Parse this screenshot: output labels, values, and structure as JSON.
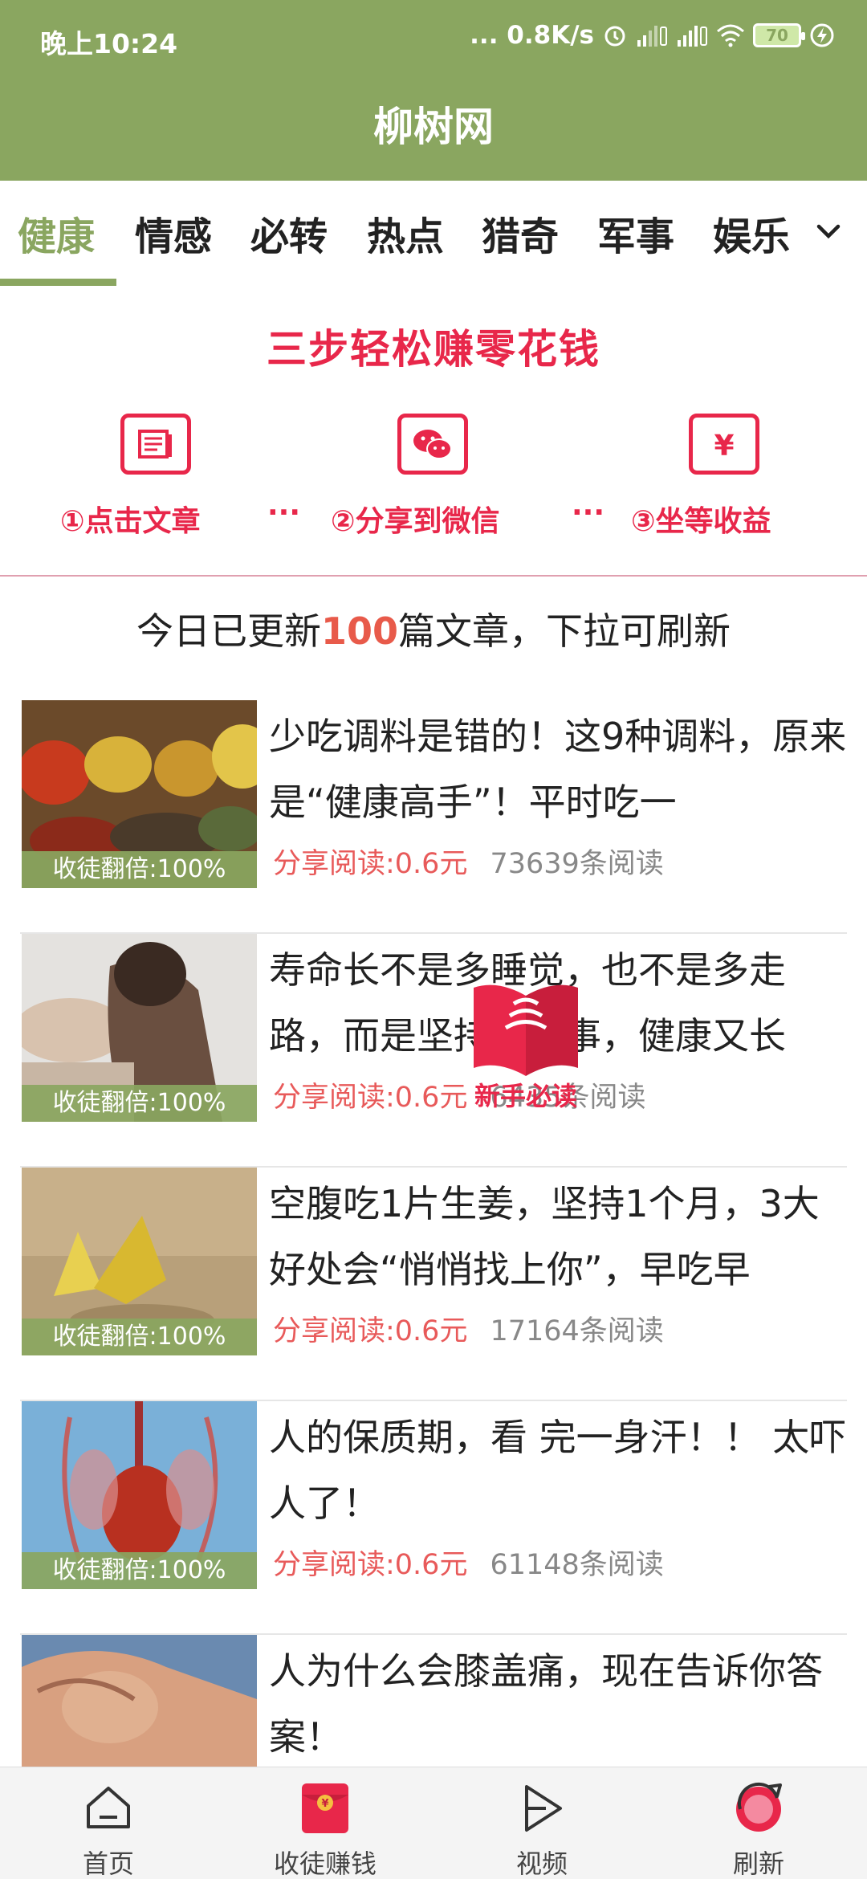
{
  "status_bar": {
    "time": "晚上10:24",
    "net_speed": "... 0.8K/s",
    "battery": "70"
  },
  "app": {
    "title": "柳树网"
  },
  "tabs": [
    {
      "label": "健康",
      "active": true
    },
    {
      "label": "情感"
    },
    {
      "label": "必转"
    },
    {
      "label": "热点"
    },
    {
      "label": "猎奇"
    },
    {
      "label": "军事"
    },
    {
      "label": "娱乐"
    }
  ],
  "promo": {
    "title": "三步轻松赚零花钱",
    "steps": [
      {
        "label": "①点击文章",
        "icon": "article-icon"
      },
      {
        "label": "②分享到微信",
        "icon": "wechat-icon"
      },
      {
        "label": "③坐等收益",
        "icon": "yuan-icon"
      }
    ],
    "dots": "···"
  },
  "notice": {
    "prefix": "今日已更新",
    "count": "100",
    "suffix": "篇文章，下拉可刷新"
  },
  "articles": [
    {
      "title": "少吃调料是错的！这9种调料，原来是“健康高手”！平时吃一",
      "badge": "收徒翻倍:100%",
      "share": "分享阅读:0.6元",
      "reads": "73639条阅读"
    },
    {
      "title": " 寿命长不是多睡觉，也不是多走路，而是坚持一件事，健康又长",
      "badge": "收徒翻倍:100%",
      "share": "分享阅读:0.6元",
      "reads": "6435条阅读"
    },
    {
      "title": "空腹吃1片生姜，坚持1个月，3大好处会“悄悄找上你”，早吃早",
      "badge": "收徒翻倍:100%",
      "share": "分享阅读:0.6元",
      "reads": "17164条阅读"
    },
    {
      "title": "人的保质期，看 完一身汗！！ 太吓人了！",
      "badge": "收徒翻倍:100%",
      "share": "分享阅读:0.6元",
      "reads": "61148条阅读"
    },
    {
      "title": " 人为什么会膝盖痛，现在告诉你答案！",
      "badge": "",
      "share": "",
      "reads": ""
    }
  ],
  "float_badge": {
    "label": "新手必读",
    "icon": "book-icon"
  },
  "bottom_nav": [
    {
      "label": "首页",
      "icon": "home-icon"
    },
    {
      "label": "收徒赚钱",
      "icon": "red-envelope-icon"
    },
    {
      "label": "视频",
      "icon": "play-icon"
    },
    {
      "label": "刷新",
      "icon": "refresh-icon"
    }
  ],
  "colors": {
    "brand_green": "#8aa660",
    "accent_red": "#e8274a",
    "price_red": "#e85a5a"
  }
}
